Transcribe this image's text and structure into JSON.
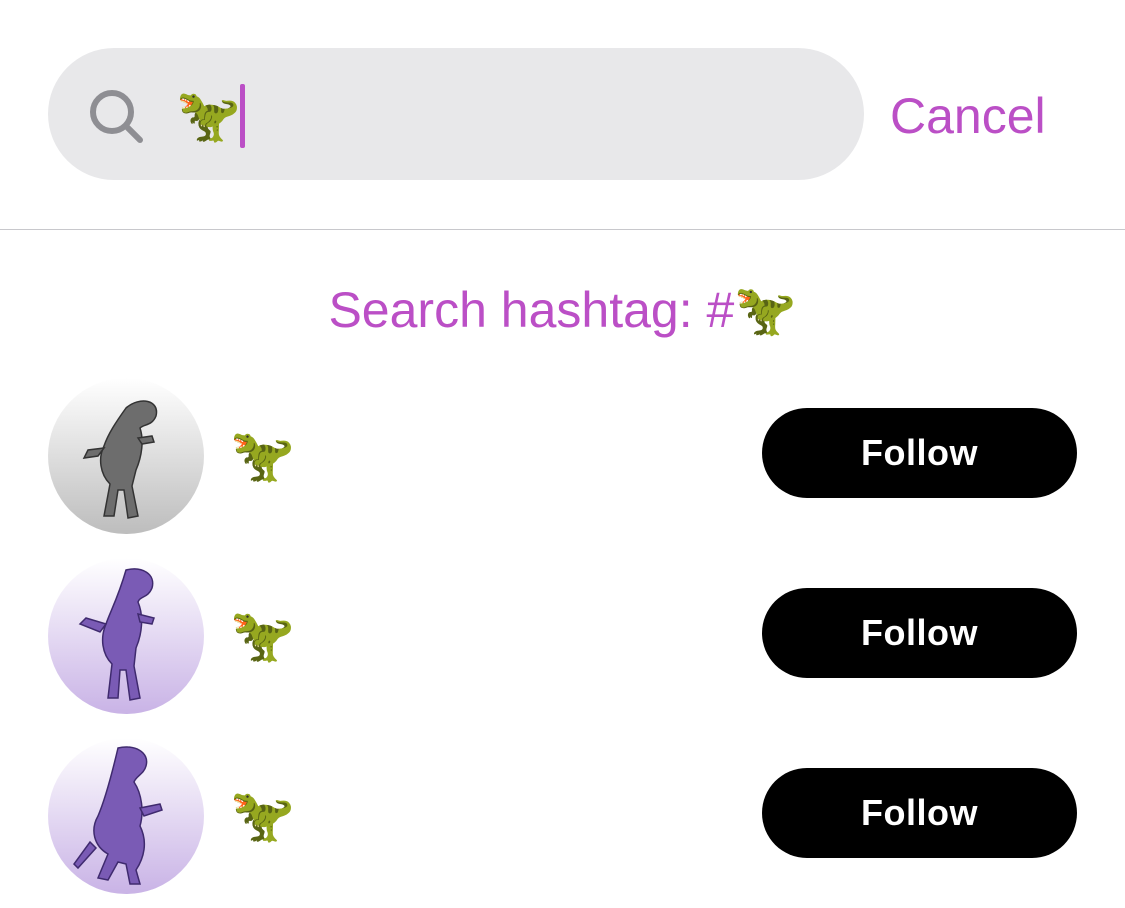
{
  "search": {
    "query": "🦖",
    "icon": "search-icon",
    "cancel_label": "Cancel"
  },
  "hashtag_search_label": "Search hashtag: #🦖",
  "colors": {
    "accent": "#bb4fc6",
    "field_bg": "#e8e8ea",
    "button_bg": "#000000"
  },
  "results": [
    {
      "title": "🦖",
      "avatar": "gray-trex-avatar",
      "follow_label": "Follow"
    },
    {
      "title": "🦖",
      "avatar": "purple-trex-avatar",
      "follow_label": "Follow"
    },
    {
      "title": "🦖",
      "avatar": "purple-trex-roaring-avatar",
      "follow_label": "Follow"
    }
  ]
}
